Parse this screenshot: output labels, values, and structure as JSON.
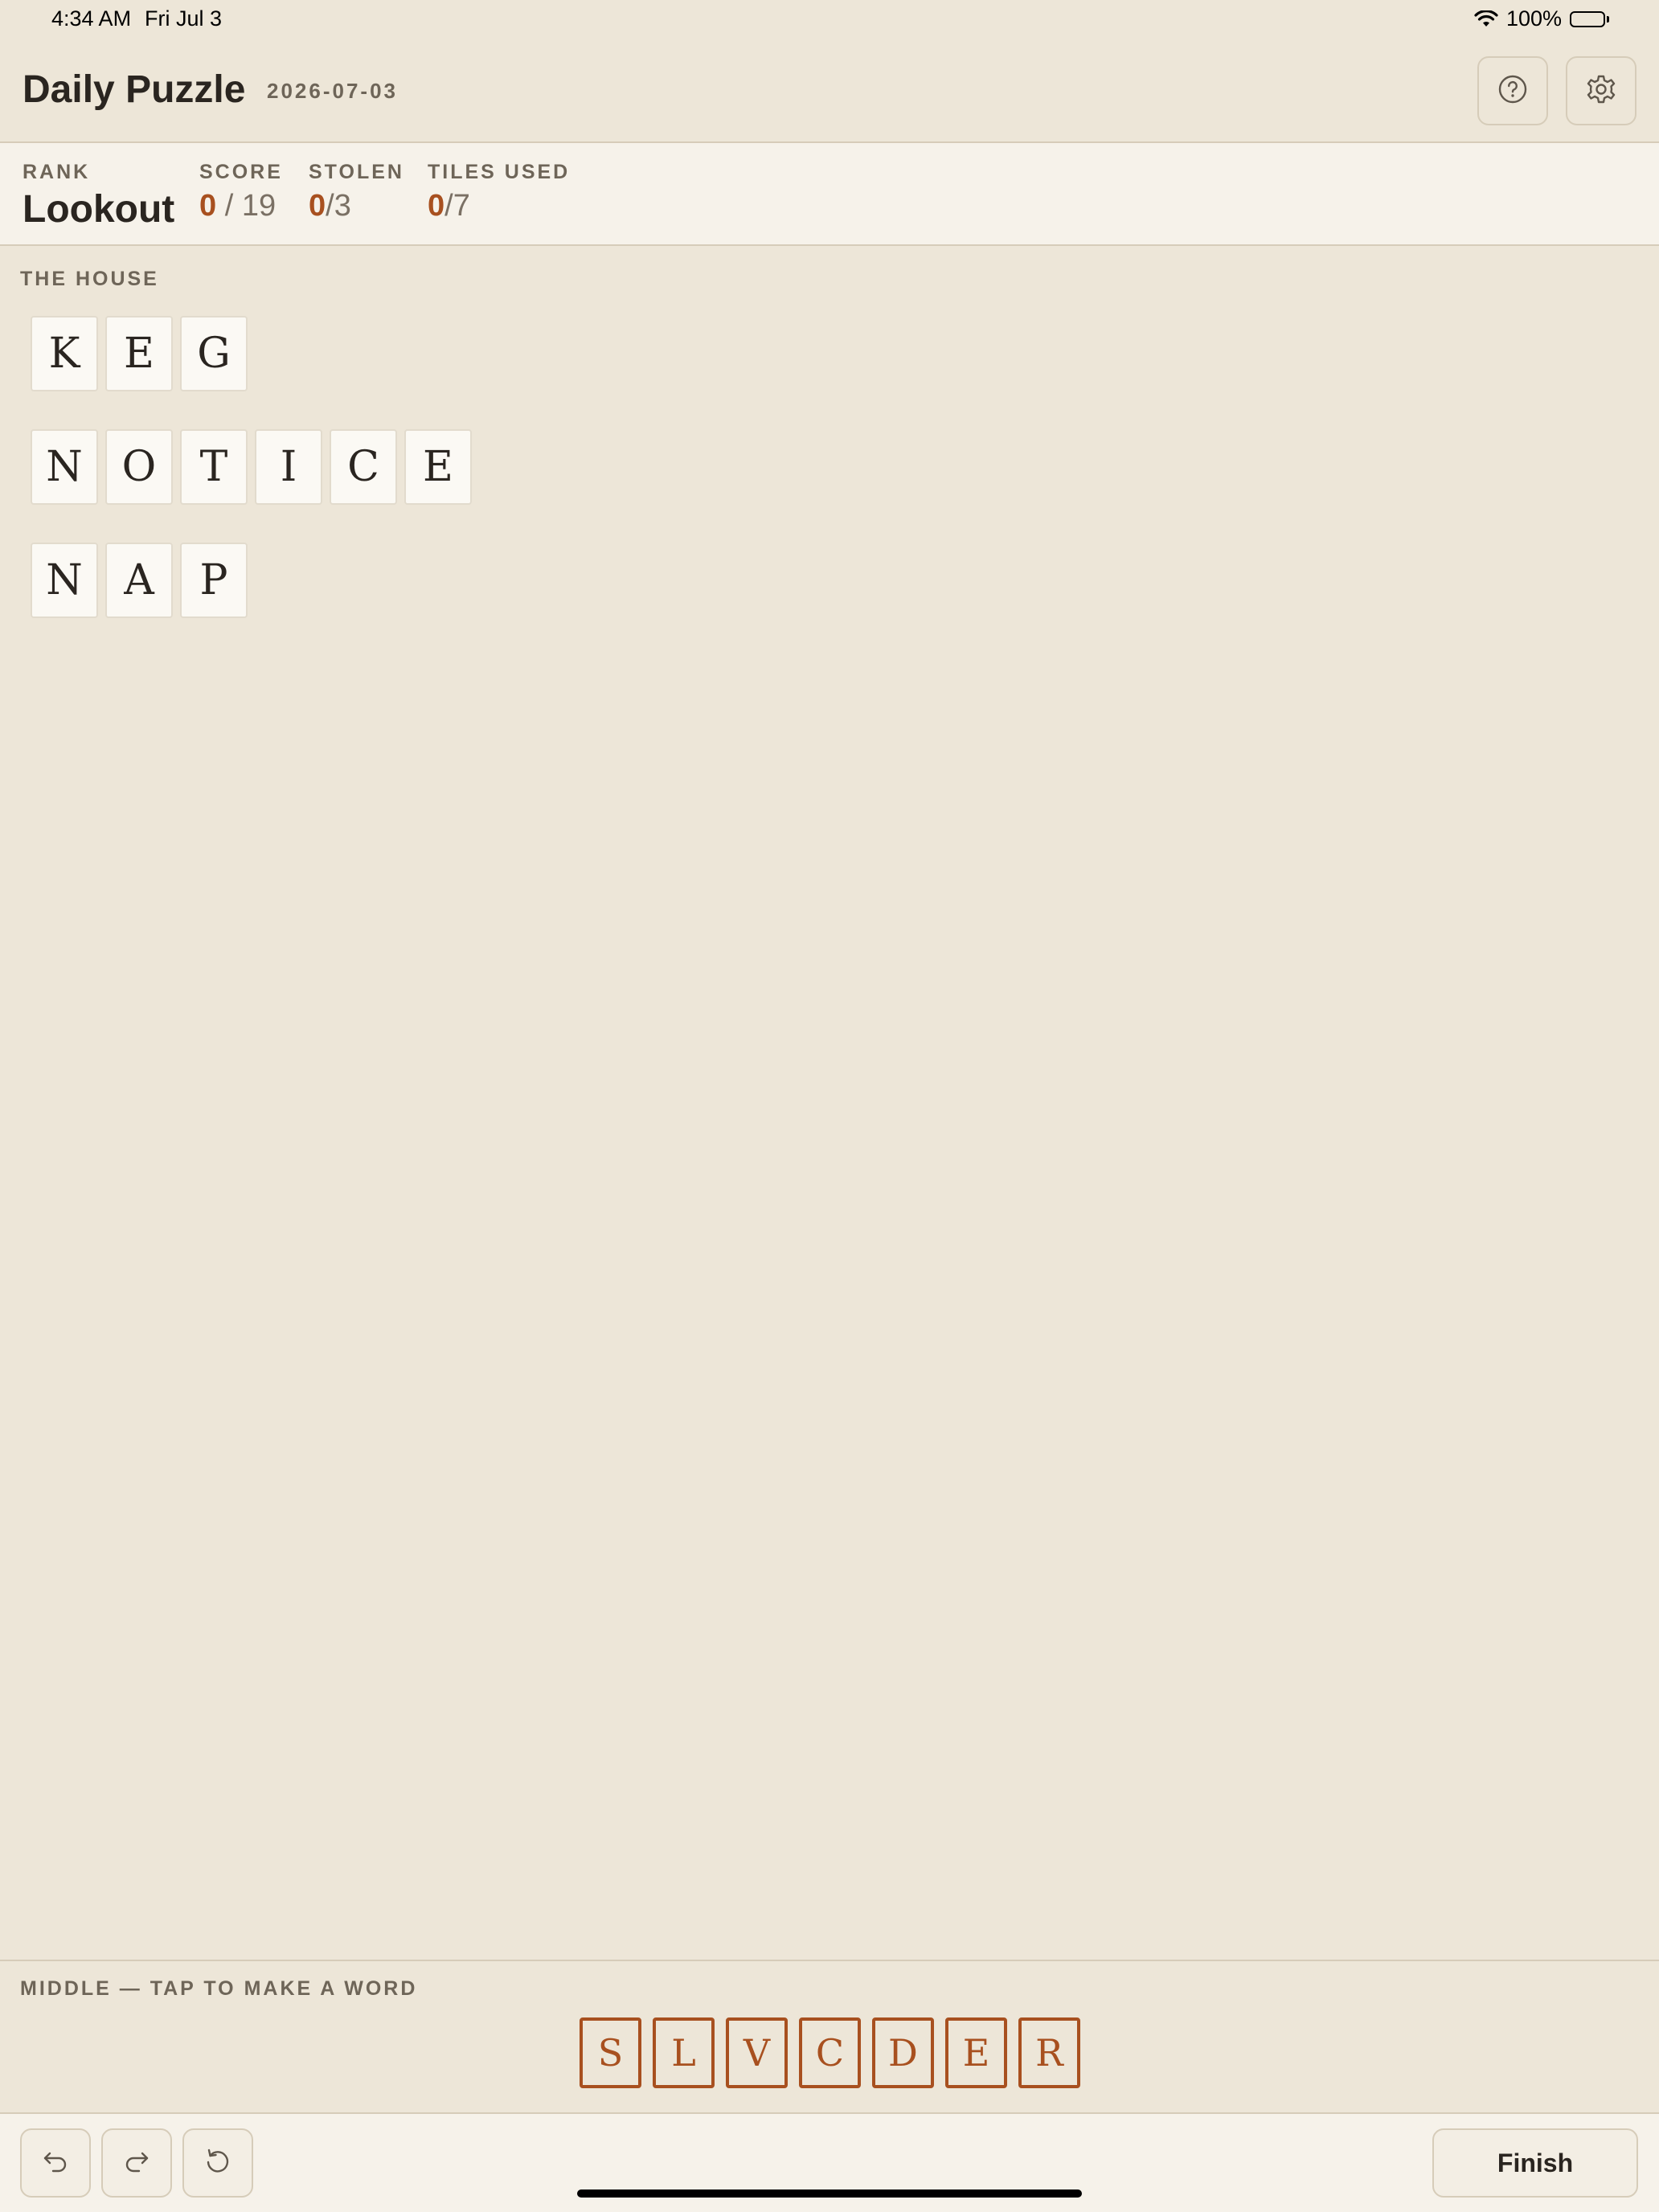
{
  "status_bar": {
    "time": "4:34 AM",
    "date": "Fri Jul 3",
    "battery": "100%",
    "icons": [
      "wifi-icon",
      "battery-icon"
    ]
  },
  "header": {
    "title": "Daily Puzzle",
    "date": "2026-07-03",
    "help_icon": "help-circle-icon",
    "settings_icon": "gear-icon"
  },
  "stats": {
    "rank_label": "RANK",
    "rank_value": "Lookout",
    "score_label": "SCORE",
    "score_current": "0",
    "score_total": " / 19",
    "stolen_label": "STOLEN",
    "stolen_current": "0",
    "stolen_total": "/3",
    "tiles_label": "TILES USED",
    "tiles_current": "0",
    "tiles_total": "/7"
  },
  "house": {
    "label": "THE HOUSE",
    "words": [
      [
        "K",
        "E",
        "G"
      ],
      [
        "N",
        "O",
        "T",
        "I",
        "C",
        "E"
      ],
      [
        "N",
        "A",
        "P"
      ]
    ]
  },
  "middle": {
    "label": "MIDDLE — TAP TO MAKE A WORD",
    "tiles": [
      "S",
      "L",
      "V",
      "C",
      "D",
      "E",
      "R"
    ]
  },
  "toolbar": {
    "undo_icon": "undo-icon",
    "redo_icon": "redo-icon",
    "reset_icon": "reset-icon",
    "finish_label": "Finish"
  },
  "colors": {
    "background": "#ede6d8",
    "panel": "#f6f2ea",
    "accent": "#a8501f",
    "text": "#2a2520",
    "muted": "#6e6558"
  }
}
